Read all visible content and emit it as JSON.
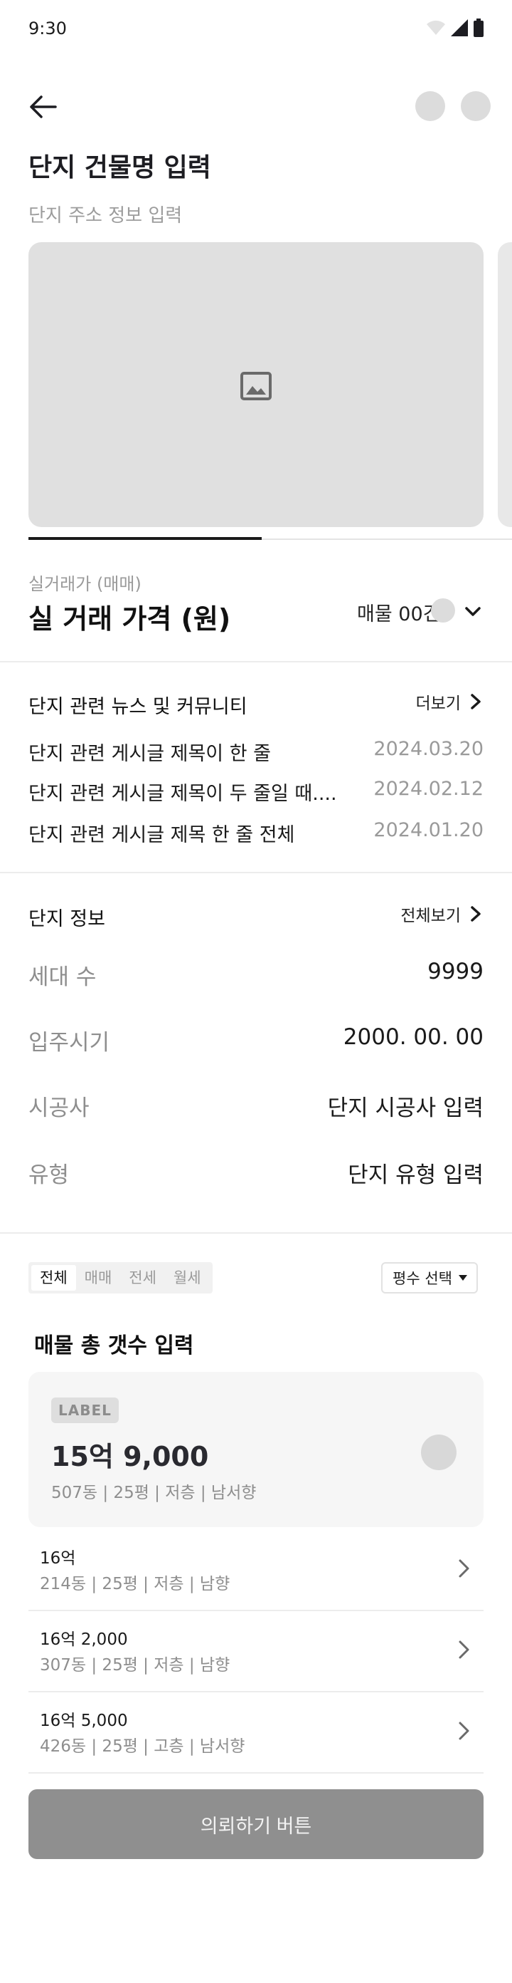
{
  "status_bar": {
    "time": "9:30"
  },
  "header": {
    "title": "단지 건물명 입력",
    "subtitle": "단지 주소 정보 입력"
  },
  "price": {
    "label": "실거래가 (매매)",
    "title": "실 거래 가격 (원)",
    "listing_count": "매물 00건"
  },
  "news": {
    "title": "단지 관련 뉴스 및 커뮤니티",
    "more": "더보기",
    "items": [
      {
        "title": "단지 관련 게시글 제목이 한 줄",
        "date": "2024.03.20"
      },
      {
        "title": "단지 관련 게시글 제목이 두 줄일 때....",
        "date": "2024.02.12"
      },
      {
        "title": "단지 관련 게시글 제목 한 줄 전체",
        "date": "2024.01.20"
      }
    ]
  },
  "info": {
    "title": "단지 정보",
    "more": "전체보기",
    "rows": [
      {
        "key": "세대 수",
        "value": "9999"
      },
      {
        "key": "입주시기",
        "value": "2000. 00. 00"
      },
      {
        "key": "시공사",
        "value": "단지 시공사 입력"
      },
      {
        "key": "유형",
        "value": "단지 유형 입력"
      }
    ]
  },
  "filter": {
    "tabs": [
      "전체",
      "매매",
      "전세",
      "월세"
    ],
    "active_tab": "전체",
    "select_label": "평수 선택"
  },
  "listings": {
    "count_title": "매물 총 갯수 입력",
    "featured": {
      "label": "LABEL",
      "price": "15억 9,000",
      "meta": "507동 | 25평 | 저층 | 남서향"
    },
    "items": [
      {
        "price": "16억",
        "meta": "214동 | 25평 | 저층 | 남향"
      },
      {
        "price": "16억 2,000",
        "meta": "307동 | 25평 | 저층 | 남향"
      },
      {
        "price": "16억 5,000",
        "meta": "426동 | 25평 | 고층 | 남서향"
      }
    ]
  },
  "cta": {
    "label": "의뢰하기 버튼"
  },
  "colors": {
    "placeholder": "#e0e0e0",
    "cta_bg": "#8f8f8f",
    "card_bg": "#f6f6f6",
    "muted_text": "#9a9a9a"
  }
}
